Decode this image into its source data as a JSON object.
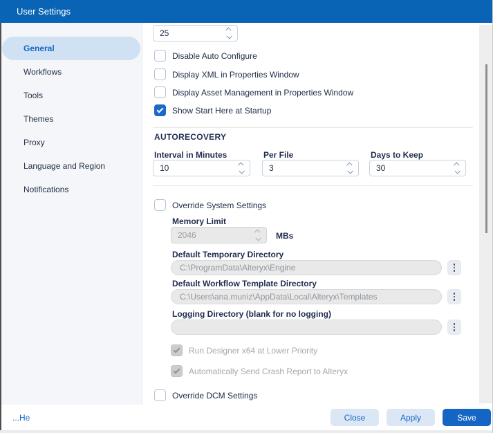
{
  "window": {
    "title": "User Settings"
  },
  "colors": {
    "titlebar": "#0a64b5",
    "accent_blue": "#1566c4",
    "selected_pill": "#cfe1f3",
    "sidebar_bg": "#f4f6f9",
    "disabled_bg": "#e9e9e9"
  },
  "sidebar": {
    "items": [
      {
        "label": "General",
        "selected": true
      },
      {
        "label": "Workflows",
        "selected": false
      },
      {
        "label": "Tools",
        "selected": false
      },
      {
        "label": "Themes",
        "selected": false
      },
      {
        "label": "Proxy",
        "selected": false
      },
      {
        "label": "Language and Region",
        "selected": false
      },
      {
        "label": "Notifications",
        "selected": false
      }
    ]
  },
  "content": {
    "top_spinner": {
      "value": "25"
    },
    "checkboxes_top": [
      {
        "label": "Disable Auto Configure",
        "checked": false
      },
      {
        "label": "Display XML in Properties Window",
        "checked": false
      },
      {
        "label": "Display Asset Management in Properties Window",
        "checked": false
      },
      {
        "label": "Show Start Here at Startup",
        "checked": true
      }
    ],
    "autorecovery": {
      "heading": "AUTORECOVERY",
      "fields": [
        {
          "label": "Interval in Minutes",
          "value": "10"
        },
        {
          "label": "Per File",
          "value": "3"
        },
        {
          "label": "Days to Keep",
          "value": "30"
        }
      ]
    },
    "system": {
      "override_checkbox": {
        "label": "Override System Settings",
        "checked": false
      },
      "memory": {
        "label": "Memory Limit",
        "value": "2046",
        "unit": "MBs"
      },
      "directories": [
        {
          "label": "Default Temporary Directory",
          "value": "C:\\ProgramData\\Alteryx\\Engine"
        },
        {
          "label": "Default Workflow Template Directory",
          "value": "C:\\Users\\ana.muniz\\AppData\\Local\\Alteryx\\Templates"
        },
        {
          "label": "Logging Directory (blank for no logging)",
          "value": ""
        }
      ],
      "disabled_checkboxes": [
        {
          "label": "Run Designer x64 at Lower Priority",
          "checked": true
        },
        {
          "label": "Automatically Send Crash Report to Alteryx",
          "checked": true
        }
      ]
    },
    "dcm_checkbox": {
      "label": "Override DCM Settings",
      "checked": false
    }
  },
  "footer": {
    "help_link": "...He",
    "buttons": [
      {
        "label": "Close",
        "primary": false
      },
      {
        "label": "Apply",
        "primary": false
      },
      {
        "label": "Save",
        "primary": true
      }
    ]
  }
}
